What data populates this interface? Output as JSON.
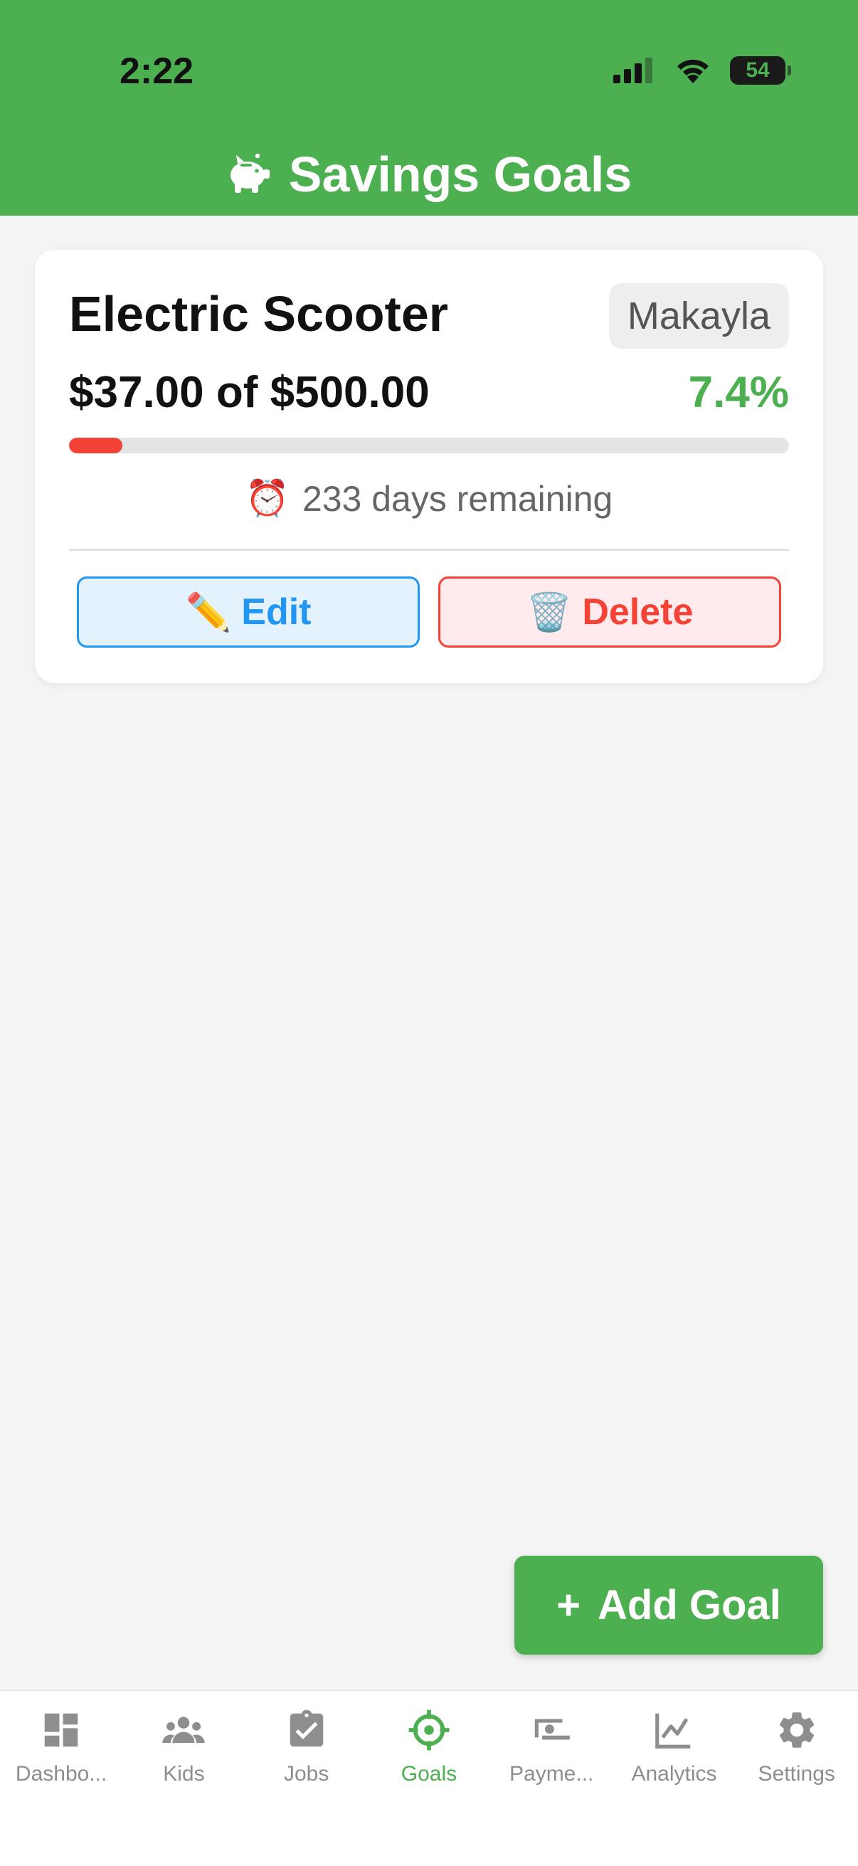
{
  "status_bar": {
    "time": "2:22",
    "battery": "54"
  },
  "header": {
    "title": "Savings Goals",
    "icon": "piggy-bank-icon"
  },
  "goal": {
    "name": "Electric Scooter",
    "kid": "Makayla",
    "amount_text": "$37.00 of $500.00",
    "percent_text": "7.4%",
    "progress_percent": 7.4,
    "remaining_emoji": "⏰",
    "remaining_text": "233 days remaining",
    "edit_emoji": "✏️",
    "edit_label": "Edit",
    "delete_emoji": "🗑️",
    "delete_label": "Delete"
  },
  "fab": {
    "plus": "+",
    "label": "Add Goal"
  },
  "tabs": [
    {
      "label": "Dashbo...",
      "icon": "dashboard-icon"
    },
    {
      "label": "Kids",
      "icon": "people-icon"
    },
    {
      "label": "Jobs",
      "icon": "clipboard-check-icon"
    },
    {
      "label": "Goals",
      "icon": "target-icon",
      "active": true
    },
    {
      "label": "Payme...",
      "icon": "payment-icon"
    },
    {
      "label": "Analytics",
      "icon": "chart-line-icon"
    },
    {
      "label": "Settings",
      "icon": "gear-icon"
    }
  ],
  "colors": {
    "primary": "#4caf50",
    "edit": "#2196f3",
    "delete": "#f44336",
    "inactive": "#8e8e8e"
  }
}
